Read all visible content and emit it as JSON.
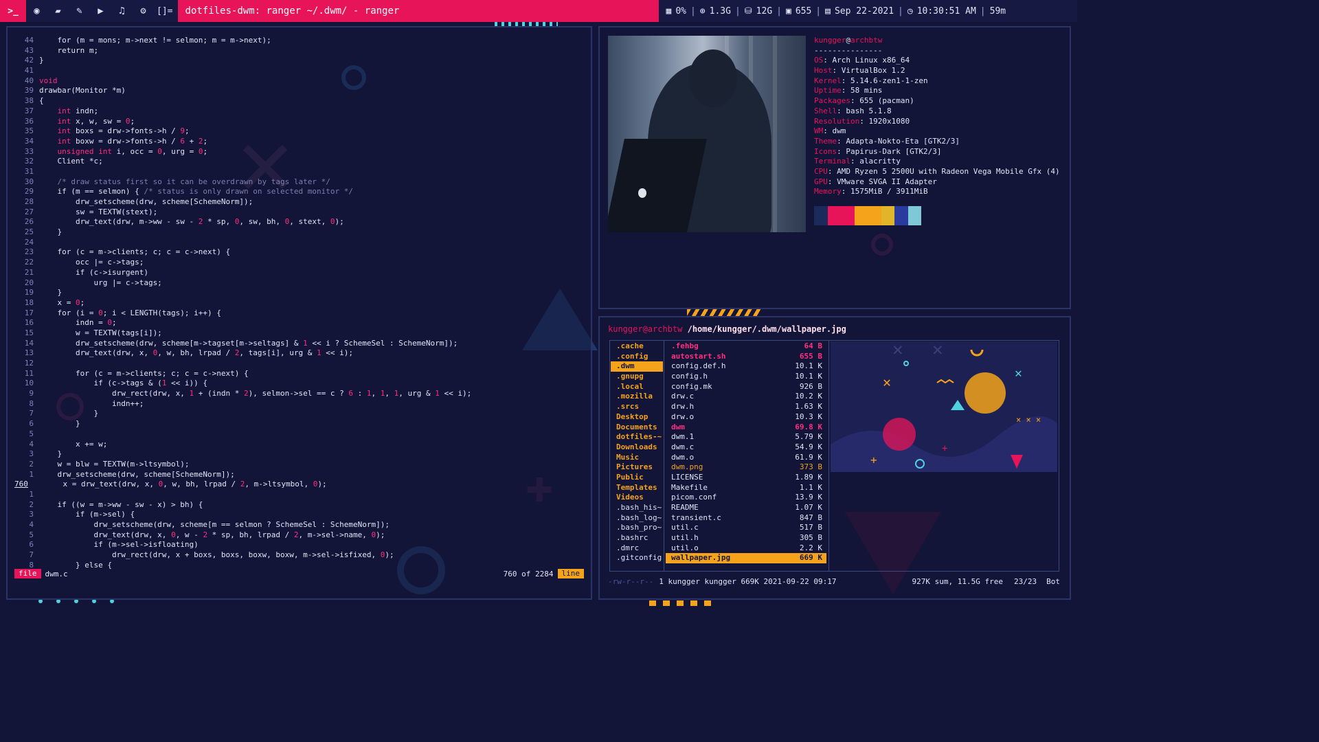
{
  "topbar": {
    "launcher": ">_",
    "icons": [
      "firefox-icon",
      "folder-icon",
      "edit-icon",
      "video-icon",
      "music-icon",
      "gear-icon"
    ],
    "layout_symbol": "[]=",
    "window_title": "dotfiles-dwm: ranger ~/.dwm/ - ranger",
    "status": {
      "cpu": "0%",
      "mem": "1.3G",
      "disk": "12G",
      "packages": "655",
      "date": "Sep 22-2021",
      "time": "10:30:51 AM",
      "uptime": "59m"
    }
  },
  "editor": {
    "lines": [
      {
        "n": "44",
        "t": "    for (m = mons; m->next != selmon; m = m->next);"
      },
      {
        "n": "43",
        "t": "    return m;"
      },
      {
        "n": "42",
        "t": "}"
      },
      {
        "n": "41",
        "t": ""
      },
      {
        "n": "40",
        "t": "void"
      },
      {
        "n": "39",
        "t": "drawbar(Monitor *m)"
      },
      {
        "n": "38",
        "t": "{"
      },
      {
        "n": "37",
        "t": "    int indn;"
      },
      {
        "n": "36",
        "t": "    int x, w, sw = 0;"
      },
      {
        "n": "35",
        "t": "    int boxs = drw->fonts->h / 9;"
      },
      {
        "n": "34",
        "t": "    int boxw = drw->fonts->h / 6 + 2;"
      },
      {
        "n": "33",
        "t": "    unsigned int i, occ = 0, urg = 0;"
      },
      {
        "n": "32",
        "t": "    Client *c;"
      },
      {
        "n": "31",
        "t": ""
      },
      {
        "n": "30",
        "t": "    /* draw status first so it can be overdrawn by tags later */"
      },
      {
        "n": "29",
        "t": "    if (m == selmon) { /* status is only drawn on selected monitor */"
      },
      {
        "n": "28",
        "t": "        drw_setscheme(drw, scheme[SchemeNorm]);"
      },
      {
        "n": "27",
        "t": "        sw = TEXTW(stext);"
      },
      {
        "n": "26",
        "t": "        drw_text(drw, m->ww - sw - 2 * sp, 0, sw, bh, 0, stext, 0);"
      },
      {
        "n": "25",
        "t": "    }"
      },
      {
        "n": "24",
        "t": ""
      },
      {
        "n": "23",
        "t": "    for (c = m->clients; c; c = c->next) {"
      },
      {
        "n": "22",
        "t": "        occ |= c->tags;"
      },
      {
        "n": "21",
        "t": "        if (c->isurgent)"
      },
      {
        "n": "20",
        "t": "            urg |= c->tags;"
      },
      {
        "n": "19",
        "t": "    }"
      },
      {
        "n": "18",
        "t": "    x = 0;"
      },
      {
        "n": "17",
        "t": "    for (i = 0; i < LENGTH(tags); i++) {"
      },
      {
        "n": "16",
        "t": "        indn = 0;"
      },
      {
        "n": "15",
        "t": "        w = TEXTW(tags[i]);"
      },
      {
        "n": "14",
        "t": "        drw_setscheme(drw, scheme[m->tagset[m->seltags] & 1 << i ? SchemeSel : SchemeNorm]);"
      },
      {
        "n": "13",
        "t": "        drw_text(drw, x, 0, w, bh, lrpad / 2, tags[i], urg & 1 << i);"
      },
      {
        "n": "12",
        "t": ""
      },
      {
        "n": "11",
        "t": "        for (c = m->clients; c; c = c->next) {"
      },
      {
        "n": "10",
        "t": "            if (c->tags & (1 << i)) {"
      },
      {
        "n": "9",
        "t": "                drw_rect(drw, x, 1 + (indn * 2), selmon->sel == c ? 6 : 1, 1, 1, urg & 1 << i);"
      },
      {
        "n": "8",
        "t": "                indn++;"
      },
      {
        "n": "7",
        "t": "            }"
      },
      {
        "n": "6",
        "t": "        }"
      },
      {
        "n": "5",
        "t": ""
      },
      {
        "n": "4",
        "t": "        x += w;"
      },
      {
        "n": "3",
        "t": "    }"
      },
      {
        "n": "2",
        "t": "    w = blw = TEXTW(m->ltsymbol);"
      },
      {
        "n": "1",
        "t": "    drw_setscheme(drw, scheme[SchemeNorm]);"
      },
      {
        "n": "760",
        "t": "    x = drw_text(drw, x, 0, w, bh, lrpad / 2, m->ltsymbol, 0);",
        "current": true
      },
      {
        "n": "1",
        "t": ""
      },
      {
        "n": "2",
        "t": "    if ((w = m->ww - sw - x) > bh) {"
      },
      {
        "n": "3",
        "t": "        if (m->sel) {"
      },
      {
        "n": "4",
        "t": "            drw_setscheme(drw, scheme[m == selmon ? SchemeSel : SchemeNorm]);"
      },
      {
        "n": "5",
        "t": "            drw_text(drw, x, 0, w - 2 * sp, bh, lrpad / 2, m->sel->name, 0);"
      },
      {
        "n": "6",
        "t": "            if (m->sel->isfloating)"
      },
      {
        "n": "7",
        "t": "                drw_rect(drw, x + boxs, boxs, boxw, boxw, m->sel->isfixed, 0);"
      },
      {
        "n": "8",
        "t": "        } else {"
      }
    ],
    "status": {
      "mode": "file",
      "filename": "dwm.c",
      "position": "760 of 2284",
      "line_label": "line"
    }
  },
  "fetch": {
    "user": "kungger",
    "host": "archbtw",
    "rule": "---------------",
    "info": [
      {
        "k": "OS",
        "v": "Arch Linux x86_64"
      },
      {
        "k": "Host",
        "v": "VirtualBox 1.2"
      },
      {
        "k": "Kernel",
        "v": "5.14.6-zen1-1-zen"
      },
      {
        "k": "Uptime",
        "v": "58 mins"
      },
      {
        "k": "Packages",
        "v": "655 (pacman)"
      },
      {
        "k": "Shell",
        "v": "bash 5.1.8"
      },
      {
        "k": "Resolution",
        "v": "1920x1080"
      },
      {
        "k": "WM",
        "v": "dwm"
      },
      {
        "k": "Theme",
        "v": "Adapta-Nokto-Eta [GTK2/3]"
      },
      {
        "k": "Icons",
        "v": "Papirus-Dark [GTK2/3]"
      },
      {
        "k": "Terminal",
        "v": "alacritty"
      },
      {
        "k": "CPU",
        "v": "AMD Ryzen 5 2500U with Radeon Vega Mobile Gfx (4)"
      },
      {
        "k": "GPU",
        "v": "VMware SVGA II Adapter"
      },
      {
        "k": "Memory",
        "v": "1575MiB / 3911MiB"
      }
    ],
    "palette": [
      "#1a2a5a",
      "#e8145a",
      "#e8145a",
      "#f5a31b",
      "#f5a31b",
      "#e0b52a",
      "#2a3ba0",
      "#7ec8d8"
    ]
  },
  "ranger": {
    "user_host": "kungger@archbtw",
    "path": "/home/kungger/.dwm/wallpaper.jpg",
    "parent_items": [
      {
        "name": ".cache",
        "type": "dir"
      },
      {
        "name": ".config",
        "type": "dir"
      },
      {
        "name": ".dwm",
        "type": "dir",
        "selected": true
      },
      {
        "name": ".gnupg",
        "type": "dir"
      },
      {
        "name": ".local",
        "type": "dir"
      },
      {
        "name": ".mozilla",
        "type": "dir"
      },
      {
        "name": ".srcs",
        "type": "dir"
      },
      {
        "name": "Desktop",
        "type": "dir"
      },
      {
        "name": "Documents",
        "type": "dir"
      },
      {
        "name": "dotfiles-~",
        "type": "dir"
      },
      {
        "name": "Downloads",
        "type": "dir"
      },
      {
        "name": "Music",
        "type": "dir"
      },
      {
        "name": "Pictures",
        "type": "dir"
      },
      {
        "name": "Public",
        "type": "dir"
      },
      {
        "name": "Templates",
        "type": "dir"
      },
      {
        "name": "Videos",
        "type": "dir"
      },
      {
        "name": ".bash_his~",
        "type": "file"
      },
      {
        "name": ".bash_log~",
        "type": "file"
      },
      {
        "name": ".bash_pro~",
        "type": "file"
      },
      {
        "name": ".bashrc",
        "type": "file"
      },
      {
        "name": ".dmrc",
        "type": "file"
      },
      {
        "name": ".gitconfig",
        "type": "file"
      }
    ],
    "files": [
      {
        "name": ".fehbg",
        "size": "64 B",
        "type": "exe"
      },
      {
        "name": "autostart.sh",
        "size": "655 B",
        "type": "exe"
      },
      {
        "name": "config.def.h",
        "size": "10.1 K",
        "type": "plain"
      },
      {
        "name": "config.h",
        "size": "10.1 K",
        "type": "plain"
      },
      {
        "name": "config.mk",
        "size": "926 B",
        "type": "plain"
      },
      {
        "name": "drw.c",
        "size": "10.2 K",
        "type": "plain"
      },
      {
        "name": "drw.h",
        "size": "1.63 K",
        "type": "plain"
      },
      {
        "name": "drw.o",
        "size": "10.3 K",
        "type": "plain"
      },
      {
        "name": "dwm",
        "size": "69.8 K",
        "type": "exe"
      },
      {
        "name": "dwm.1",
        "size": "5.79 K",
        "type": "plain"
      },
      {
        "name": "dwm.c",
        "size": "54.9 K",
        "type": "plain"
      },
      {
        "name": "dwm.o",
        "size": "61.9 K",
        "type": "plain"
      },
      {
        "name": "dwm.png",
        "size": "373 B",
        "type": "img"
      },
      {
        "name": "LICENSE",
        "size": "1.89 K",
        "type": "plain"
      },
      {
        "name": "Makefile",
        "size": "1.1 K",
        "type": "plain"
      },
      {
        "name": "picom.conf",
        "size": "13.9 K",
        "type": "plain"
      },
      {
        "name": "README",
        "size": "1.07 K",
        "type": "plain"
      },
      {
        "name": "transient.c",
        "size": "847 B",
        "type": "plain"
      },
      {
        "name": "util.c",
        "size": "517 B",
        "type": "plain"
      },
      {
        "name": "util.h",
        "size": "305 B",
        "type": "plain"
      },
      {
        "name": "util.o",
        "size": "2.2 K",
        "type": "plain"
      },
      {
        "name": "wallpaper.jpg",
        "size": "669 K",
        "type": "img",
        "selected": true
      }
    ],
    "footer": {
      "perms": "-rw-r--r--",
      "info": "1 kungger kungger 669K 2021-09-22 09:17",
      "summary": "927K sum, 11.5G free",
      "count": "23/23",
      "pos": "Bot"
    }
  }
}
